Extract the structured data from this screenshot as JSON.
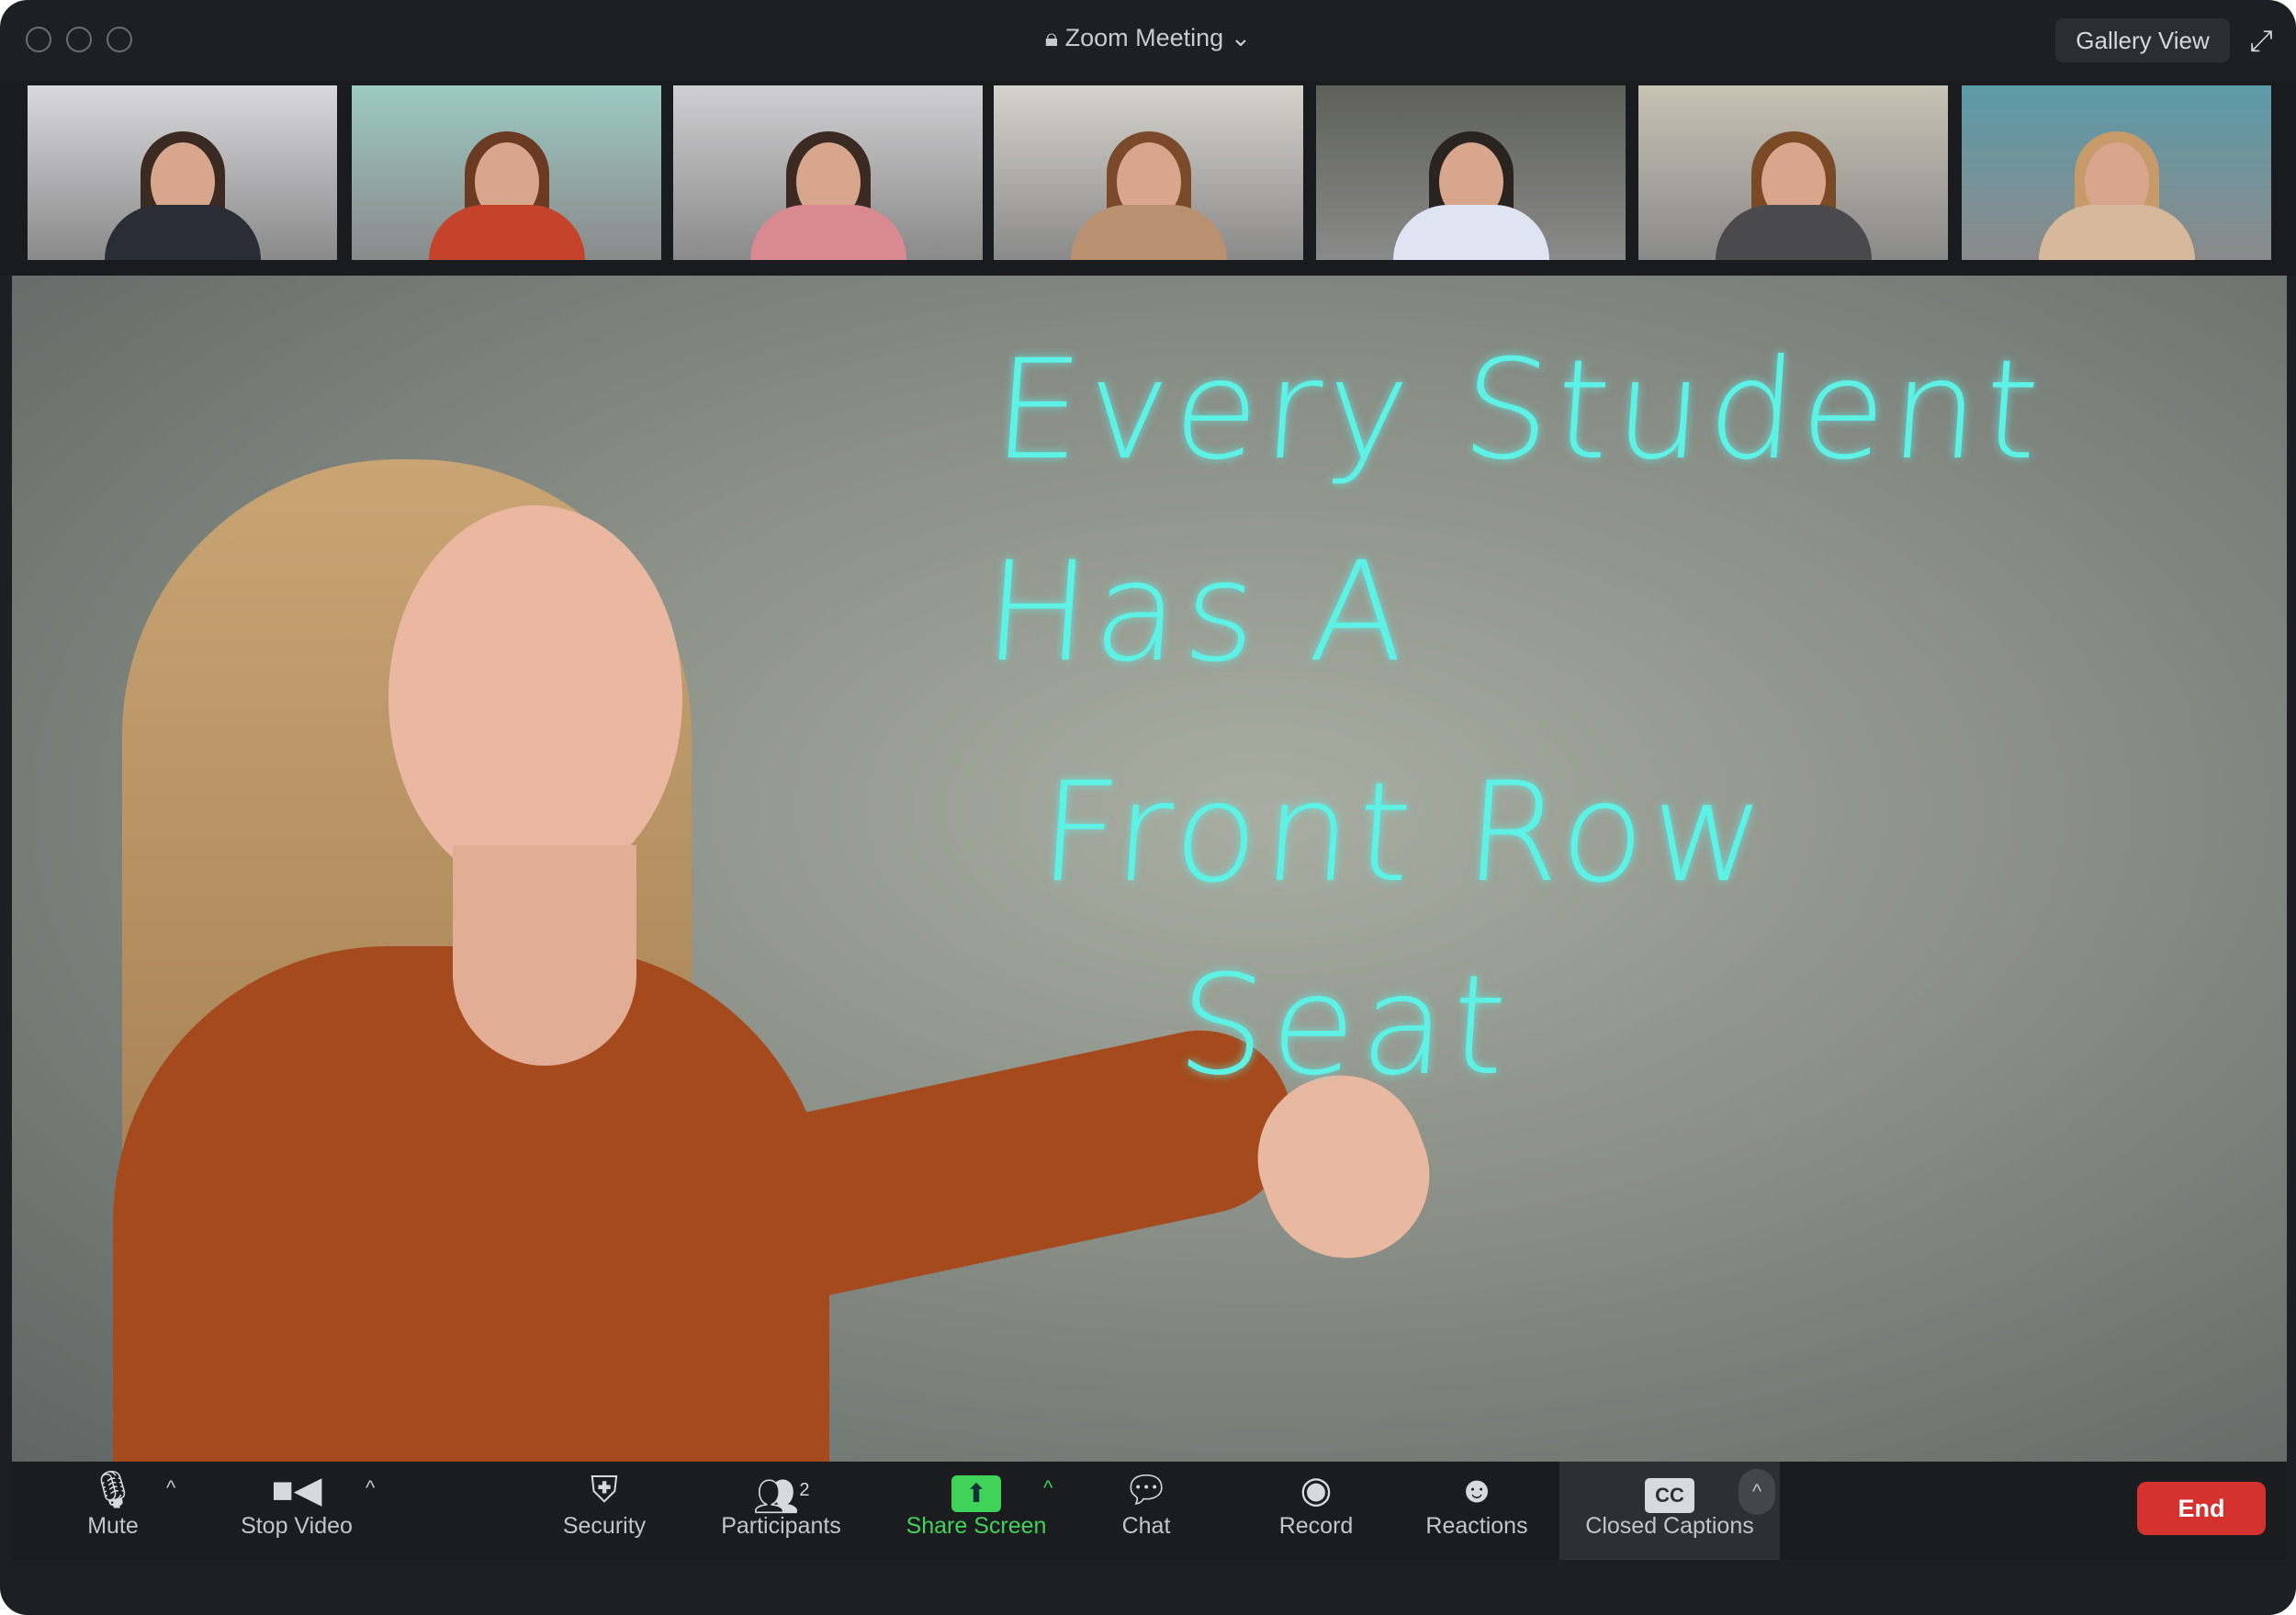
{
  "window": {
    "title": "Zoom Meeting",
    "title_icon": "lock-icon",
    "view_button": "Gallery View",
    "fullscreen_icon": "expand-icon"
  },
  "participants_strip": [
    {
      "bg": "#d9d9dd",
      "hair": "#3a2a22",
      "shirt": "#2a2c36"
    },
    {
      "bg": "#9cc9c3",
      "hair": "#6b3a22",
      "shirt": "#c4432a"
    },
    {
      "bg": "#cfcfd1",
      "hair": "#3b2a22",
      "shirt": "#d88a90"
    },
    {
      "bg": "#d6d2cc",
      "hair": "#7a4a2a",
      "shirt": "#b99070"
    },
    {
      "bg": "#5e6058",
      "hair": "#2a2420",
      "shirt": "#dfe4f2"
    },
    {
      "bg": "#c8c2b4",
      "hair": "#7a4a26",
      "shirt": "#4a4a4c"
    },
    {
      "bg": "#5c9aa8",
      "hair": "#c79a6a",
      "shirt": "#d8b89a"
    }
  ],
  "whiteboard_text": [
    "Every Student",
    "Has A",
    "Front Row",
    "Seat"
  ],
  "toolbar": {
    "mute": {
      "label": "Mute",
      "icon": "microphone-icon"
    },
    "stop_video": {
      "label": "Stop Video",
      "icon": "video-camera-icon"
    },
    "security": {
      "label": "Security",
      "icon": "shield-icon"
    },
    "participants": {
      "label": "Participants",
      "count": "2",
      "icon": "participants-icon"
    },
    "share_screen": {
      "label": "Share Screen",
      "icon": "share-screen-icon"
    },
    "chat": {
      "label": "Chat",
      "icon": "chat-bubble-icon"
    },
    "record": {
      "label": "Record",
      "icon": "record-icon"
    },
    "reactions": {
      "label": "Reactions",
      "icon": "smiley-icon"
    },
    "closed_captions": {
      "label": "Closed Captions",
      "icon_text": "CC"
    },
    "end": "End"
  },
  "colors": {
    "accent_green": "#3fd35a",
    "end_red": "#d5312f",
    "ink": "#5ef2e6"
  }
}
